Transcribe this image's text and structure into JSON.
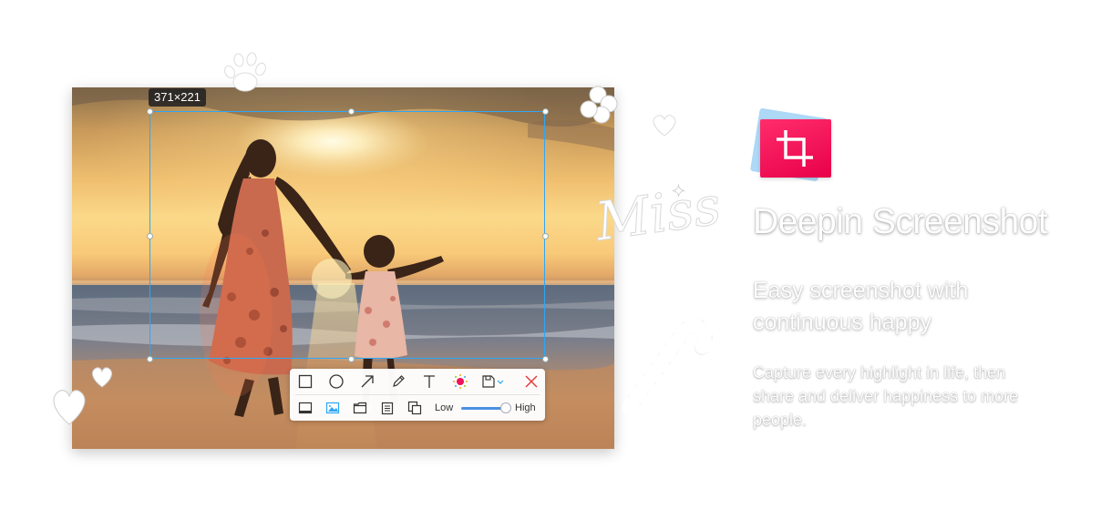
{
  "selection": {
    "size_label": "371×221"
  },
  "toolbar": {
    "row1": [
      {
        "name": "rectangle-tool-button",
        "icon": "rectangle-icon"
      },
      {
        "name": "ellipse-tool-button",
        "icon": "ellipse-icon"
      },
      {
        "name": "arrow-tool-button",
        "icon": "arrow-icon"
      },
      {
        "name": "pencil-tool-button",
        "icon": "pencil-icon"
      },
      {
        "name": "text-tool-button",
        "icon": "text-icon"
      },
      {
        "name": "color-picker-button",
        "icon": "color-dot-icon"
      },
      {
        "name": "save-button",
        "icon": "save-icon"
      },
      {
        "name": "close-button",
        "icon": "close-icon"
      }
    ],
    "row2": [
      {
        "name": "save-to-desktop-button",
        "icon": "desktop-icon"
      },
      {
        "name": "save-to-pictures-button",
        "icon": "picture-icon",
        "active": true
      },
      {
        "name": "save-to-folder-button",
        "icon": "folder-icon"
      },
      {
        "name": "copy-to-clipboard-button",
        "icon": "clipboard-icon"
      },
      {
        "name": "save-and-copy-button",
        "icon": "copy-icon"
      }
    ],
    "quality_low_label": "Low",
    "quality_high_label": "High",
    "quality_level": 0.98
  },
  "doodles": {
    "word": "Miss"
  },
  "product": {
    "icon": "crop-icon",
    "title": "Deepin Screenshot",
    "tagline": "Easy screenshot with continuous happy",
    "description": "Capture every highlight in life, then share and deliver happiness to more people."
  },
  "colors": {
    "accent": "#2ca7f8",
    "brand": "#f0125a",
    "close_red": "#e33b3b"
  }
}
